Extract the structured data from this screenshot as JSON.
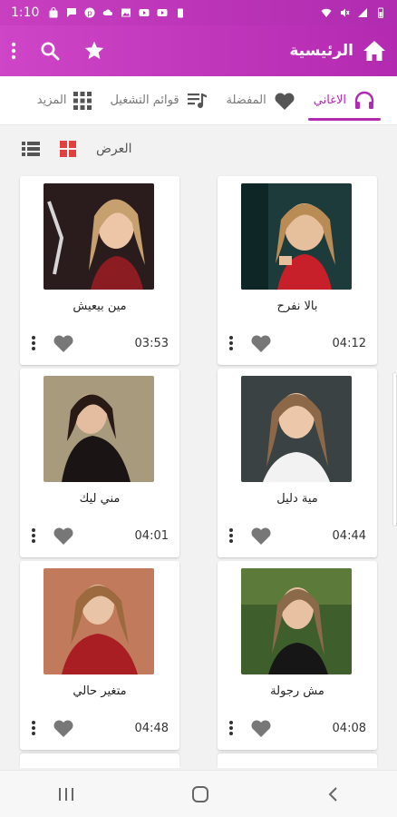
{
  "status_bar": {
    "time": "1:10"
  },
  "app_bar": {
    "title": "الرئيسية"
  },
  "tabs": [
    {
      "label": "الاغاني",
      "icon": "headphones-icon",
      "active": true
    },
    {
      "label": "المفضلة",
      "icon": "heart-icon",
      "active": false
    },
    {
      "label": "قوائم التشغيل",
      "icon": "playlist-icon",
      "active": false
    },
    {
      "label": "المزيد",
      "icon": "apps-grid-icon",
      "active": false
    }
  ],
  "view": {
    "label": "العرض"
  },
  "songs": [
    {
      "title": "بالا نفرح",
      "duration": "04:12"
    },
    {
      "title": "مين بيعيش",
      "duration": "03:53"
    },
    {
      "title": "مية دليل",
      "duration": "04:44"
    },
    {
      "title": "مني ليك",
      "duration": "04:01"
    },
    {
      "title": "مش رجولة",
      "duration": "04:08"
    },
    {
      "title": "متغير حالي",
      "duration": "04:48"
    }
  ],
  "colors": {
    "accent": "#b02bb0",
    "accent_light": "#cf45c7"
  }
}
